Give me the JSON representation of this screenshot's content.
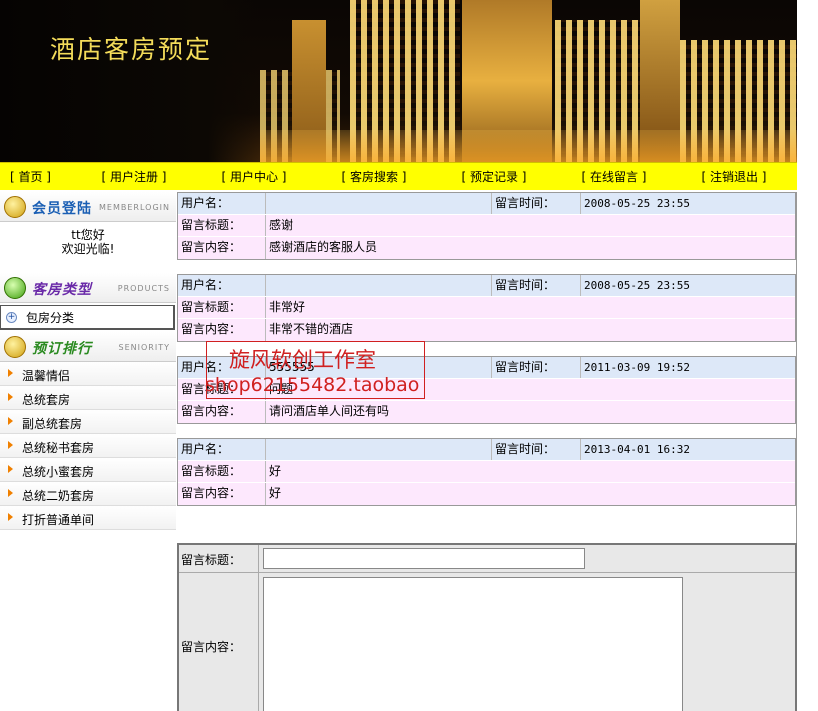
{
  "banner": {
    "title": "酒店客房预定"
  },
  "nav": {
    "items": [
      "[ 首页 ]",
      "[ 用户注册 ]",
      "[ 用户中心 ]",
      "[ 客房搜索 ]",
      "[ 预定记录 ]",
      "[ 在线留言 ]",
      "[ 注销退出 ]"
    ]
  },
  "sidebar": {
    "member": {
      "title": "会员登陆",
      "subtitle": "MEMBERLOGIN",
      "greeting": "tt您好",
      "welcome": "欢迎光临!"
    },
    "products": {
      "title": "客房类型",
      "subtitle": "PRODUCTS",
      "category": "包房分类"
    },
    "ranking": {
      "title": "预订排行",
      "subtitle": "SENIORITY",
      "items": [
        "温馨情侣",
        "总统套房",
        "副总统套房",
        "总统秘书套房",
        "总统小蜜套房",
        "总统二奶套房",
        "打折普通单间"
      ]
    }
  },
  "labels": {
    "username": "用户名：",
    "time": "留言时间：",
    "subject": "留言标题：",
    "content": "留言内容："
  },
  "messages": [
    {
      "username": "",
      "time": "2008-05-25 23:55",
      "subject": "感谢",
      "content": "感谢酒店的客服人员"
    },
    {
      "username": "",
      "time": "2008-05-25 23:55",
      "subject": "非常好",
      "content": "非常不错的酒店"
    },
    {
      "username": "555555",
      "time": "2011-03-09 19:52",
      "subject": "问题",
      "content": "请问酒店单人间还有吗"
    },
    {
      "username": "",
      "time": "2013-04-01 16:32",
      "subject": "好",
      "content": "好"
    }
  ],
  "form": {
    "subject_label": "留言标题：",
    "content_label": "留言内容：",
    "subject_value": "",
    "content_value": ""
  },
  "watermark": {
    "line1": "旋风软创工作室",
    "line2": "shop62155482.taobao"
  }
}
